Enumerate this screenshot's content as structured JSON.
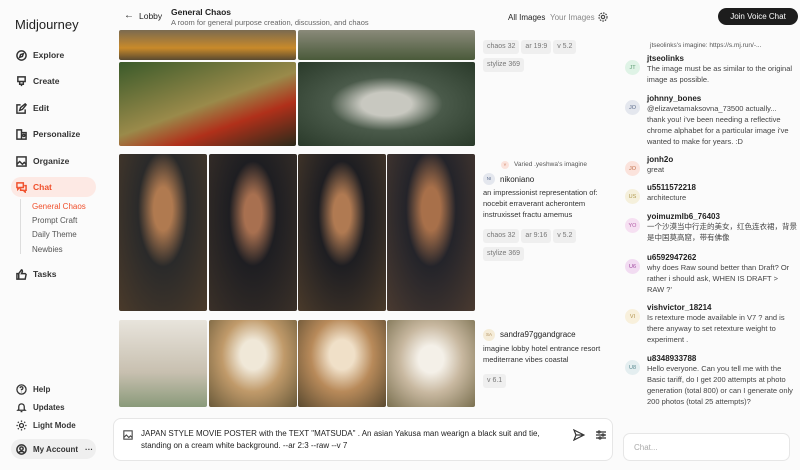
{
  "app": {
    "name": "Midjourney"
  },
  "sidebar": {
    "items": [
      {
        "label": "Explore"
      },
      {
        "label": "Create"
      },
      {
        "label": "Edit"
      },
      {
        "label": "Personalize"
      },
      {
        "label": "Organize"
      },
      {
        "label": "Chat"
      },
      {
        "label": "Tasks"
      }
    ],
    "chat_rooms": [
      "General Chaos",
      "Prompt Craft",
      "Daily Theme",
      "Newbies"
    ],
    "bottom": {
      "help": "Help",
      "updates": "Updates",
      "light_mode": "Light Mode",
      "account": "My Account",
      "more": "···"
    }
  },
  "header": {
    "back": "Lobby",
    "title": "General Chaos",
    "subtitle": "A room for general purpose creation, discussion, and chaos",
    "all_images": "All Images",
    "your_images": "Your Images",
    "join_voice": "Join Voice Chat"
  },
  "posts": [
    {
      "tags": [
        "chaos 32",
        "ar 19:9",
        "v 5.2",
        "stylize 369"
      ]
    },
    {
      "reply": "Varied .yeshwa's imagine",
      "reply_initials": "Y",
      "user": "nikoniano",
      "initials": "NI",
      "prompt": "an impressionist representation of: nocebit erraverant acherontem instruxisset fractu amemus",
      "tags": [
        "chaos 32",
        "ar 9:16",
        "v 5.2",
        "stylize 369"
      ]
    },
    {
      "user": "sandra97ggandgrace",
      "initials": "SA",
      "prompt": "imagine lobby hotel entrance resort mediterrane vibes coastal",
      "tags": [
        "v 6.1"
      ]
    }
  ],
  "chat": {
    "reply_ref": "jtseolinks's imagine: https://s.mj.run/-...",
    "messages": [
      {
        "initials": "JT",
        "user": "jtseolinks",
        "text": "The image must be as similar to the original image as possible.",
        "color": "#dff3e6",
        "fg": "#5a9a70"
      },
      {
        "initials": "JO",
        "user": "johnny_bones",
        "text": "@elizavetamaksovna_73500 actually... thank you! i've been needing a reflective chrome alphabet for a particular image i've wanted to make for years. :D",
        "color": "#e4e7ee",
        "fg": "#5a6a8a"
      },
      {
        "initials": "JO",
        "user": "jonh2o",
        "text": "great",
        "color": "#fbe3dc",
        "fg": "#c0704a"
      },
      {
        "initials": "US",
        "user": "u5511572218",
        "text": "architecture",
        "color": "#f5f0dc",
        "fg": "#b09a50"
      },
      {
        "initials": "YO",
        "user": "yoimuzmlb6_76403",
        "text": "一个沙漠当中行走的美女，红色连衣裙，背景是中国莫高窟，带有佛像",
        "color": "#f6e0f2",
        "fg": "#b05aa5"
      },
      {
        "initials": "U6",
        "user": "u6592947262",
        "text": "why does Raw sound better than Draft? Or rather i should ask, WHEN IS DRAFT > RAW ?'",
        "color": "#f2dcf2",
        "fg": "#a04aa0"
      },
      {
        "initials": "VI",
        "user": "vishvictor_18214",
        "text": "Is retexture mode available in V7 ? and is there anyway to set retexture weight to experiment .",
        "color": "#f8f0dc",
        "fg": "#b0904a"
      },
      {
        "initials": "U8",
        "user": "u8348933788",
        "text": "Hello everyone. Can you tell me with the Basic tariff, do I get 200 attempts at photo generation (total 800) or can I generate only 200 photos (total 25 attempts)?",
        "color": "#e4eef0",
        "fg": "#5a8a90"
      }
    ],
    "input_placeholder": "Chat..."
  },
  "prompt": {
    "value": "JAPAN STYLE MOVIE POSTER with the TEXT \"MATSUDA\" . An asian Yakusa man wearign a black suit and tie, standing on a cream white background. --ar 2:3 --raw --v 7"
  },
  "colors": {
    "accent": "#f0502c",
    "dark": "#1d1d1d"
  }
}
